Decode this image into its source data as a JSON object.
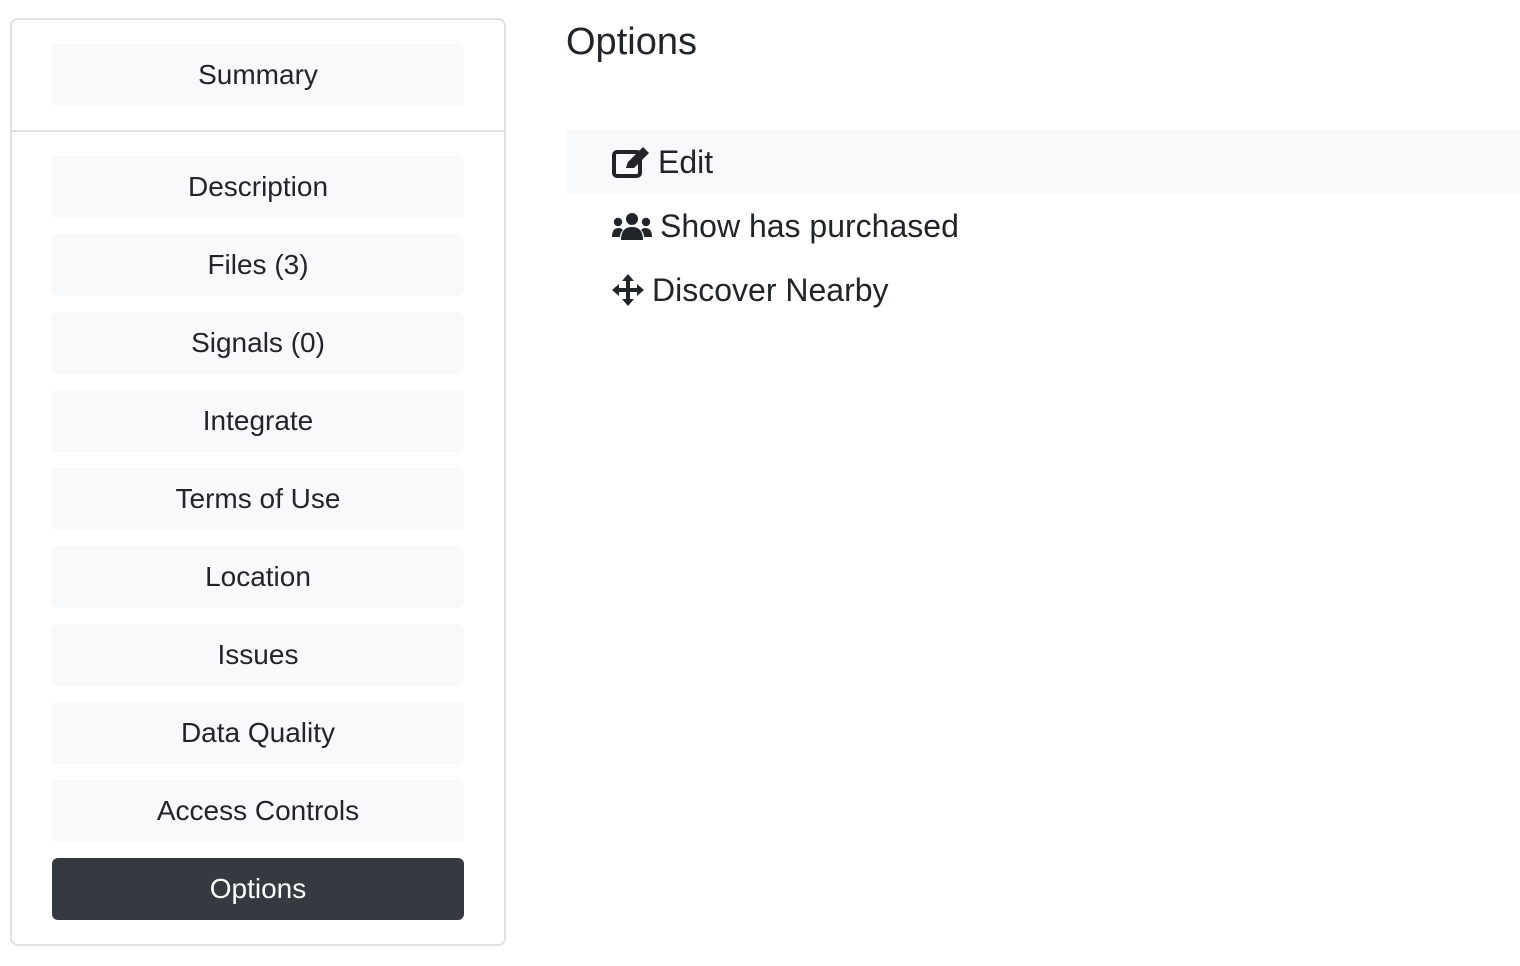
{
  "sidebar": {
    "summary_label": "Summary",
    "items": [
      {
        "label": "Description"
      },
      {
        "label": "Files (3)"
      },
      {
        "label": "Signals (0)"
      },
      {
        "label": "Integrate"
      },
      {
        "label": "Terms of Use"
      },
      {
        "label": "Location"
      },
      {
        "label": "Issues"
      },
      {
        "label": "Data Quality"
      },
      {
        "label": "Access Controls"
      },
      {
        "label": "Options"
      }
    ],
    "active_item": "Options"
  },
  "main": {
    "title": "Options",
    "options": [
      {
        "label": "Edit",
        "icon": "edit-icon"
      },
      {
        "label": "Show has purchased",
        "icon": "users-icon"
      },
      {
        "label": "Discover Nearby",
        "icon": "arrows-move-icon"
      }
    ]
  },
  "colors": {
    "active_bg": "#343a40",
    "button_bg": "#f8f9fa",
    "border": "#dee2e6",
    "text": "#212529"
  }
}
